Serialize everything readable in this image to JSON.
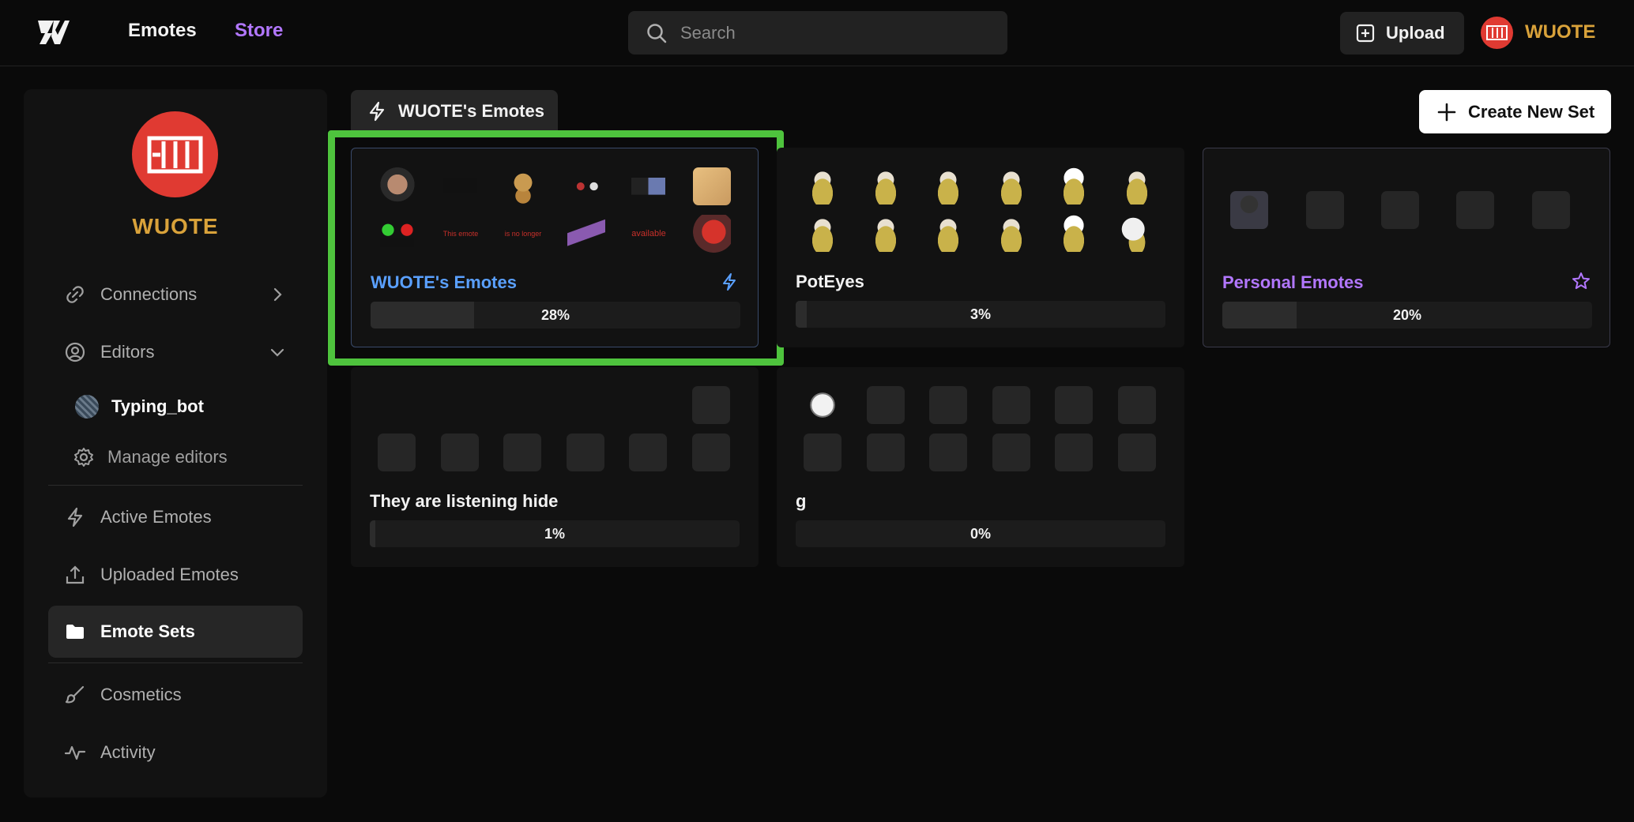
{
  "nav": {
    "emotes_label": "Emotes",
    "store_label": "Store",
    "search_placeholder": "Search",
    "upload_label": "Upload",
    "username": "WUOTE"
  },
  "sidebar": {
    "profile_name": "WUOTE",
    "connections_label": "Connections",
    "editors_label": "Editors",
    "editor_name": "Typing_bot",
    "manage_editors_label": "Manage editors",
    "active_emotes_label": "Active Emotes",
    "uploaded_emotes_label": "Uploaded Emotes",
    "emote_sets_label": "Emote Sets",
    "cosmetics_label": "Cosmetics",
    "activity_label": "Activity"
  },
  "header": {
    "active_tab_label": "WUOTE's Emotes",
    "create_button_label": "Create New Set"
  },
  "colors": {
    "accent_purple": "#b277ff",
    "accent_blue": "#5aa0ff",
    "highlight_green": "#4ec33d",
    "username_gold": "#d9a23a"
  },
  "sets": [
    {
      "name": "WUOTE's Emotes",
      "progress_label": "28%",
      "progress": 0.28,
      "icon": "bolt-icon",
      "emote_texts": [
        "This emote",
        "is no longer",
        "available"
      ]
    },
    {
      "name": "PotEyes",
      "progress_label": "3%",
      "progress": 0.03
    },
    {
      "name": "Personal Emotes",
      "progress_label": "20%",
      "progress": 0.2,
      "icon": "star-icon"
    },
    {
      "name": "They are listening hide",
      "progress_label": "1%",
      "progress": 0.01
    },
    {
      "name": "g",
      "progress_label": "0%",
      "progress": 0.0
    }
  ]
}
